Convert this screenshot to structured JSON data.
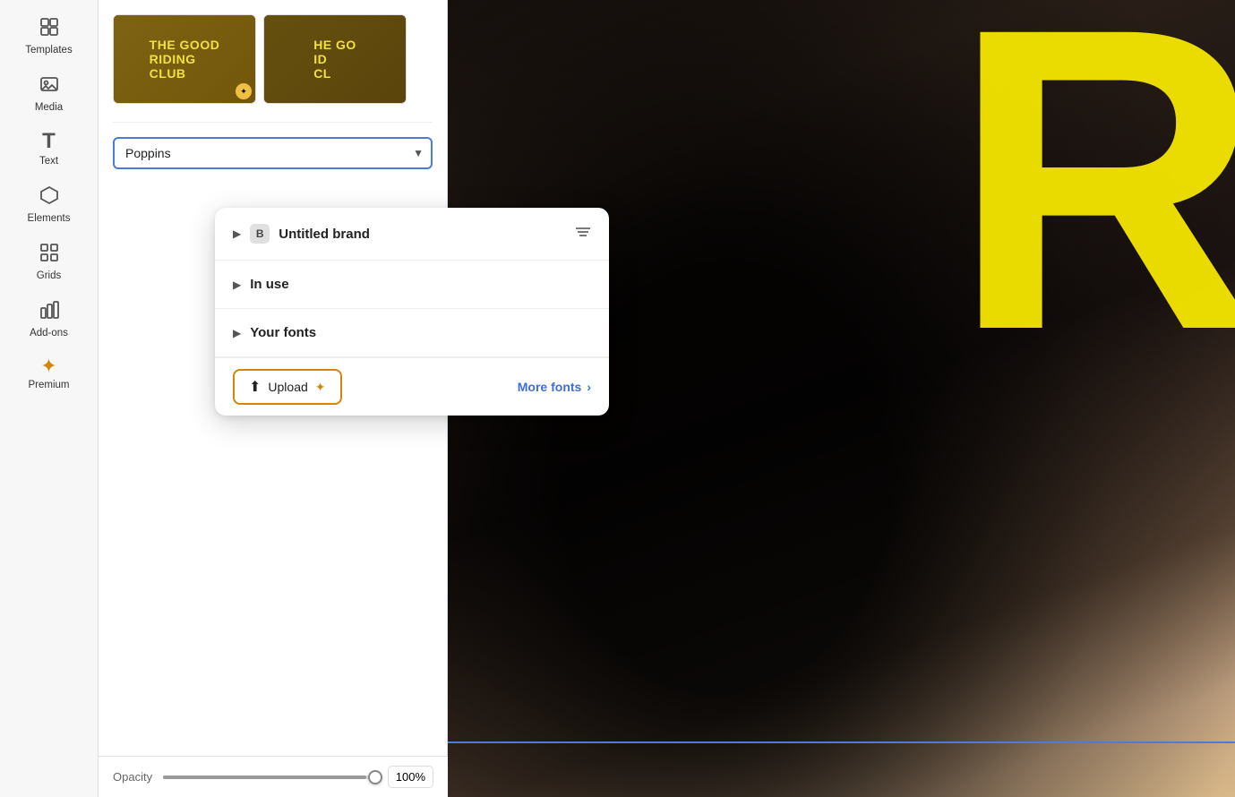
{
  "sidebar": {
    "items": [
      {
        "id": "templates",
        "label": "Templates",
        "icon": "⬡"
      },
      {
        "id": "media",
        "label": "Media",
        "icon": "⊞"
      },
      {
        "id": "text",
        "label": "Text",
        "icon": "T"
      },
      {
        "id": "elements",
        "label": "Elements",
        "icon": "◇"
      },
      {
        "id": "grids",
        "label": "Grids",
        "icon": "▦"
      },
      {
        "id": "addons",
        "label": "Add-ons",
        "icon": "🛍"
      },
      {
        "id": "premium",
        "label": "Premium",
        "icon": "★"
      }
    ]
  },
  "left_panel": {
    "font_selector": {
      "value": "Poppins",
      "placeholder": "Font name"
    },
    "opacity": {
      "label": "Opacity",
      "value": "100%",
      "percent": 100
    }
  },
  "font_dropdown": {
    "sections": [
      {
        "id": "untitled_brand",
        "label": "Untitled brand",
        "has_brand_icon": true,
        "has_filter": true
      },
      {
        "id": "in_use",
        "label": "In use",
        "has_brand_icon": false,
        "has_filter": false
      },
      {
        "id": "your_fonts",
        "label": "Your fonts",
        "has_brand_icon": false,
        "has_filter": false
      }
    ],
    "upload_button": "Upload",
    "more_fonts_button": "More fonts"
  },
  "thumbnails": [
    {
      "id": "thumb1",
      "title": "THE GOOD\nRIDING\nCLUB",
      "has_badge": true
    },
    {
      "id": "thumb2",
      "title": "HE GO\nID\nCL",
      "has_badge": false
    }
  ],
  "canvas": {
    "yellow_letter": "R"
  }
}
